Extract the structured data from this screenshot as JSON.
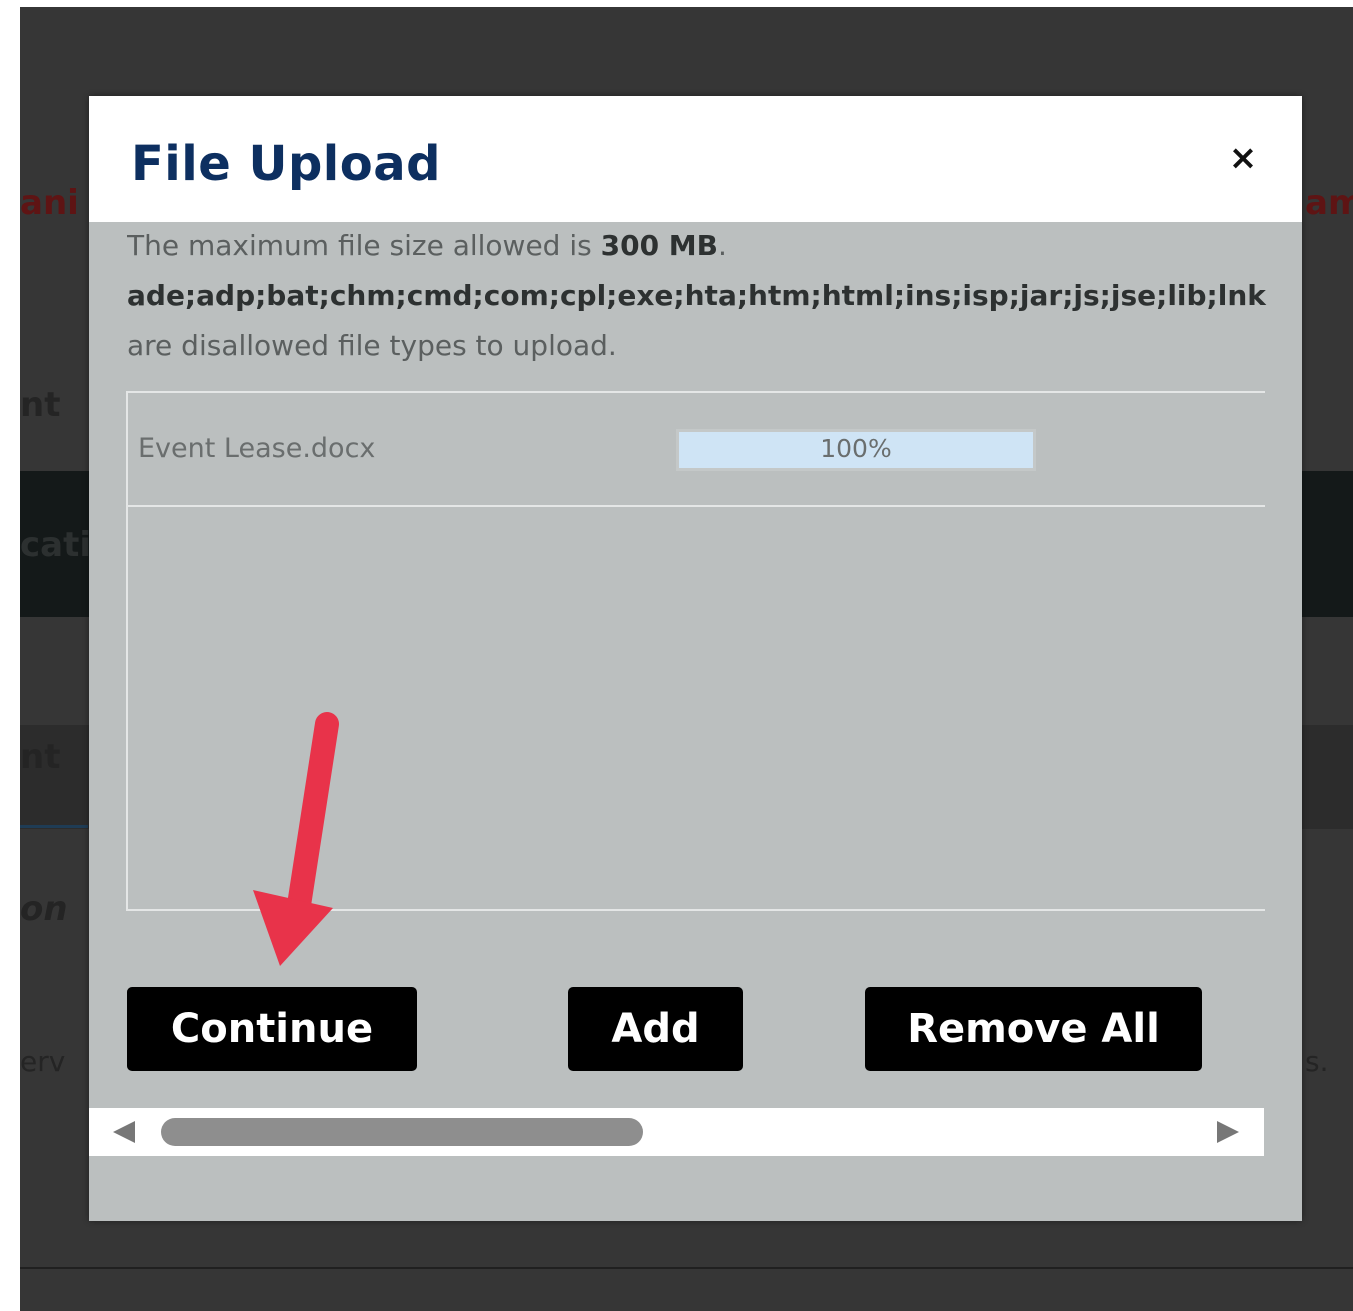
{
  "background": {
    "fragment_left_red": "ani",
    "fragment_right_red": "am",
    "fragment_nt_1": "nt",
    "fragment_catio": "catio",
    "fragment_nt_2": "nt",
    "fragment_on": "on",
    "fragment_erv": "erv",
    "fragment_s": "s."
  },
  "dialog": {
    "title": "File Upload",
    "close_label": "×",
    "max_size_prefix": "The maximum file size allowed is ",
    "max_size_value": "300 MB",
    "max_size_suffix": ".",
    "disallowed_types": "ade;adp;bat;chm;cmd;com;cpl;exe;hta;htm;html;ins;isp;jar;js;jse;lib;lnk",
    "disallowed_note": "are disallowed file types to upload."
  },
  "files": [
    {
      "name": "Event Lease.docx",
      "progress": 1.0,
      "progress_label": "100%"
    }
  ],
  "buttons": {
    "continue": "Continue",
    "add": "Add",
    "remove_all": "Remove All"
  },
  "colors": {
    "title": "#0d2f60",
    "annotation_arrow": "#e8334a",
    "progress_fill": "#cfe4f5",
    "button_bg": "#000000"
  },
  "icons": {
    "close": "close-icon",
    "scroll_left": "scroll-left-arrow-icon",
    "scroll_right": "scroll-right-arrow-icon",
    "annotation": "red-arrow-icon"
  }
}
